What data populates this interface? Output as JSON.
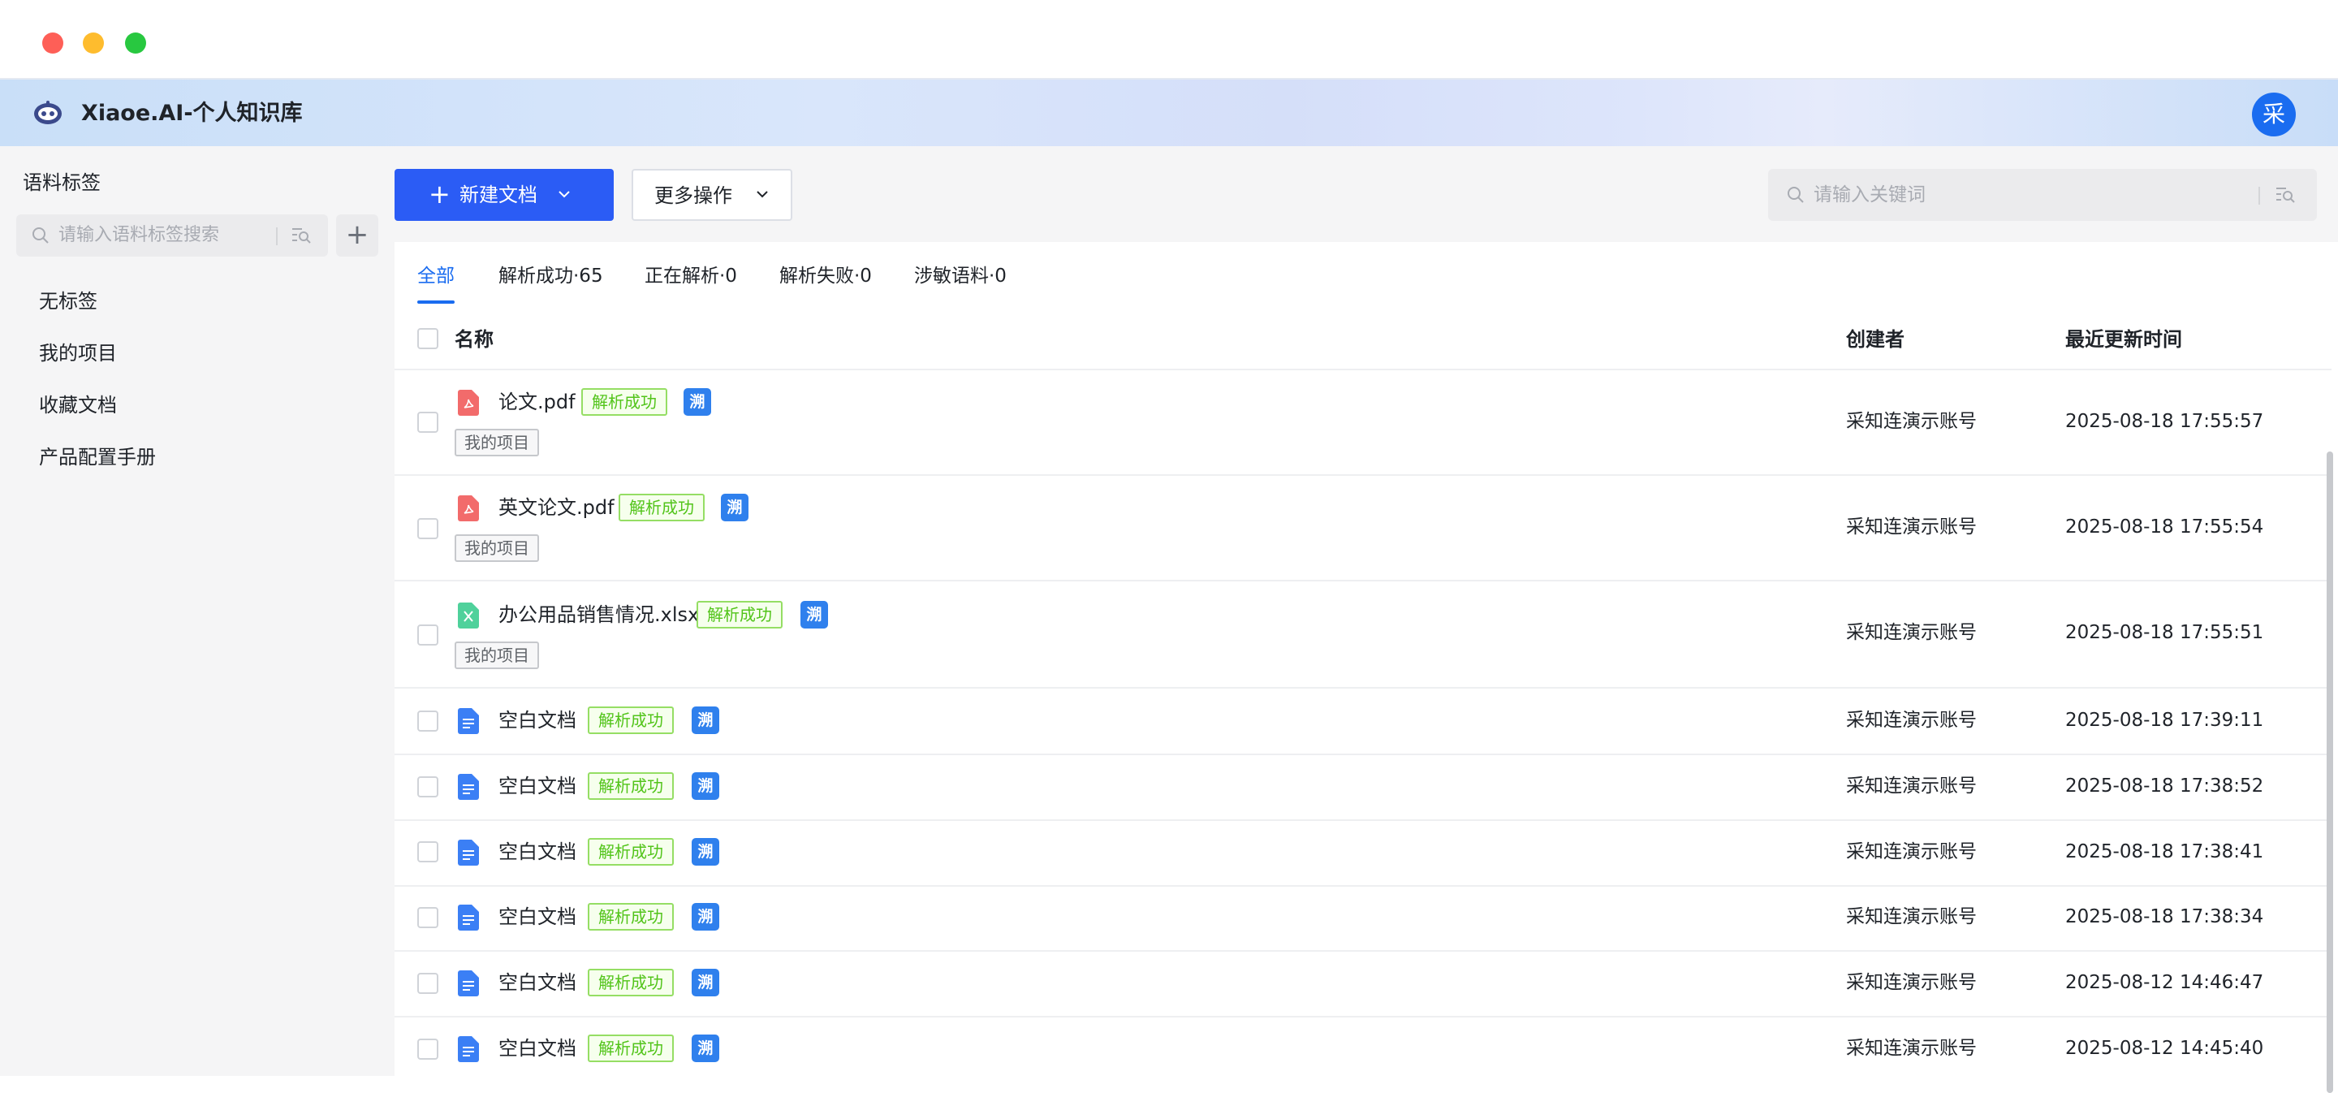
{
  "app": {
    "title": "Xiaoe.AI-个人知识库",
    "avatar_text": "采",
    "accent": "#1a6cf0",
    "primary_button_color": "#2b5cf5"
  },
  "sidebar": {
    "title": "语料标签",
    "search_placeholder": "请输入语料标签搜索",
    "add_label": "+",
    "items": [
      {
        "label": "无标签"
      },
      {
        "label": "我的项目"
      },
      {
        "label": "收藏文档"
      },
      {
        "label": "产品配置手册"
      }
    ]
  },
  "toolbar": {
    "new_doc_label": "新建文档",
    "more_ops_label": "更多操作",
    "keyword_placeholder": "请输入关键词"
  },
  "tabs": [
    {
      "label": "全部",
      "active": true
    },
    {
      "label": "解析成功·65",
      "active": false
    },
    {
      "label": "正在解析·0",
      "active": false
    },
    {
      "label": "解析失败·0",
      "active": false
    },
    {
      "label": "涉敏语料·0",
      "active": false
    }
  ],
  "table": {
    "headers": {
      "name": "名称",
      "creator": "创建者",
      "updated": "最近更新时间"
    },
    "status_label": "解析成功",
    "badge_label": "溯",
    "rows": [
      {
        "name": "论文.pdf",
        "file_icon": "pdf-icon",
        "tag": "我的项目",
        "creator": "采知连演示账号",
        "updated": "2025-08-18 17:55:57"
      },
      {
        "name": "英文论文.pdf",
        "file_icon": "pdf-icon",
        "tag": "我的项目",
        "creator": "采知连演示账号",
        "updated": "2025-08-18 17:55:54"
      },
      {
        "name": "办公用品销售情况.xlsx",
        "file_icon": "excel-icon",
        "tag": "我的项目",
        "creator": "采知连演示账号",
        "updated": "2025-08-18 17:55:51"
      },
      {
        "name": "空白文档",
        "file_icon": "doc-icon",
        "creator": "采知连演示账号",
        "updated": "2025-08-18 17:39:11"
      },
      {
        "name": "空白文档",
        "file_icon": "doc-icon",
        "creator": "采知连演示账号",
        "updated": "2025-08-18 17:38:52"
      },
      {
        "name": "空白文档",
        "file_icon": "doc-icon",
        "creator": "采知连演示账号",
        "updated": "2025-08-18 17:38:41"
      },
      {
        "name": "空白文档",
        "file_icon": "doc-icon",
        "creator": "采知连演示账号",
        "updated": "2025-08-18 17:38:34"
      },
      {
        "name": "空白文档",
        "file_icon": "doc-icon",
        "creator": "采知连演示账号",
        "updated": "2025-08-12 14:46:47"
      },
      {
        "name": "空白文档",
        "file_icon": "doc-icon",
        "creator": "采知连演示账号",
        "updated": "2025-08-12 14:45:40"
      }
    ]
  }
}
